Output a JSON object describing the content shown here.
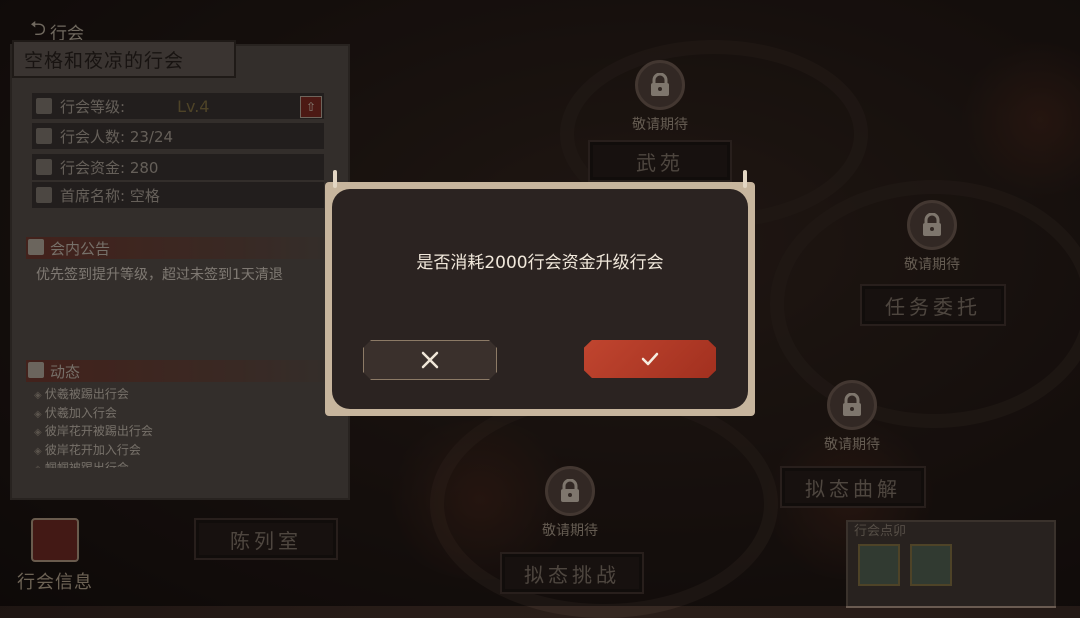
{
  "header": {
    "back_label": "行会"
  },
  "guild_panel": {
    "title": "空格和夜凉的行会",
    "rows": [
      {
        "label": "行会等级:",
        "value": "Lv.4"
      },
      {
        "label": "行会人数: 23/24"
      },
      {
        "label": "行会资金: 280"
      },
      {
        "label": "首席名称: 空格"
      }
    ],
    "notice_title": "会内公告",
    "notice_text": "优先签到提升等级，超过未签到1天清退",
    "activity_title": "动态",
    "activity_items": [
      "伏羲被踢出行会",
      "伏羲加入行会",
      "彼岸花开被踢出行会",
      "彼岸花开加入行会",
      "蝈蝈被踢出行会"
    ]
  },
  "guild_info_button": "行会信息",
  "map": {
    "nodes": [
      {
        "status": "敬请期待",
        "plaque": "武苑"
      },
      {
        "status": "敬请期待",
        "plaque": "任务委托"
      },
      {
        "status": "敬请期待",
        "plaque": "拟态曲解"
      },
      {
        "status": "敬请期待",
        "plaque": "拟态挑战"
      }
    ],
    "exhibit_plaque": "陈列室",
    "seal_box_title": "行会点卯"
  },
  "dialog": {
    "message": "是否消耗2000行会资金升级行会",
    "cancel_icon": "close-icon",
    "confirm_icon": "check-icon"
  },
  "colors": {
    "confirm": "#b53a27",
    "dialog_bg": "#2b2321",
    "frame": "#c7b59d"
  }
}
